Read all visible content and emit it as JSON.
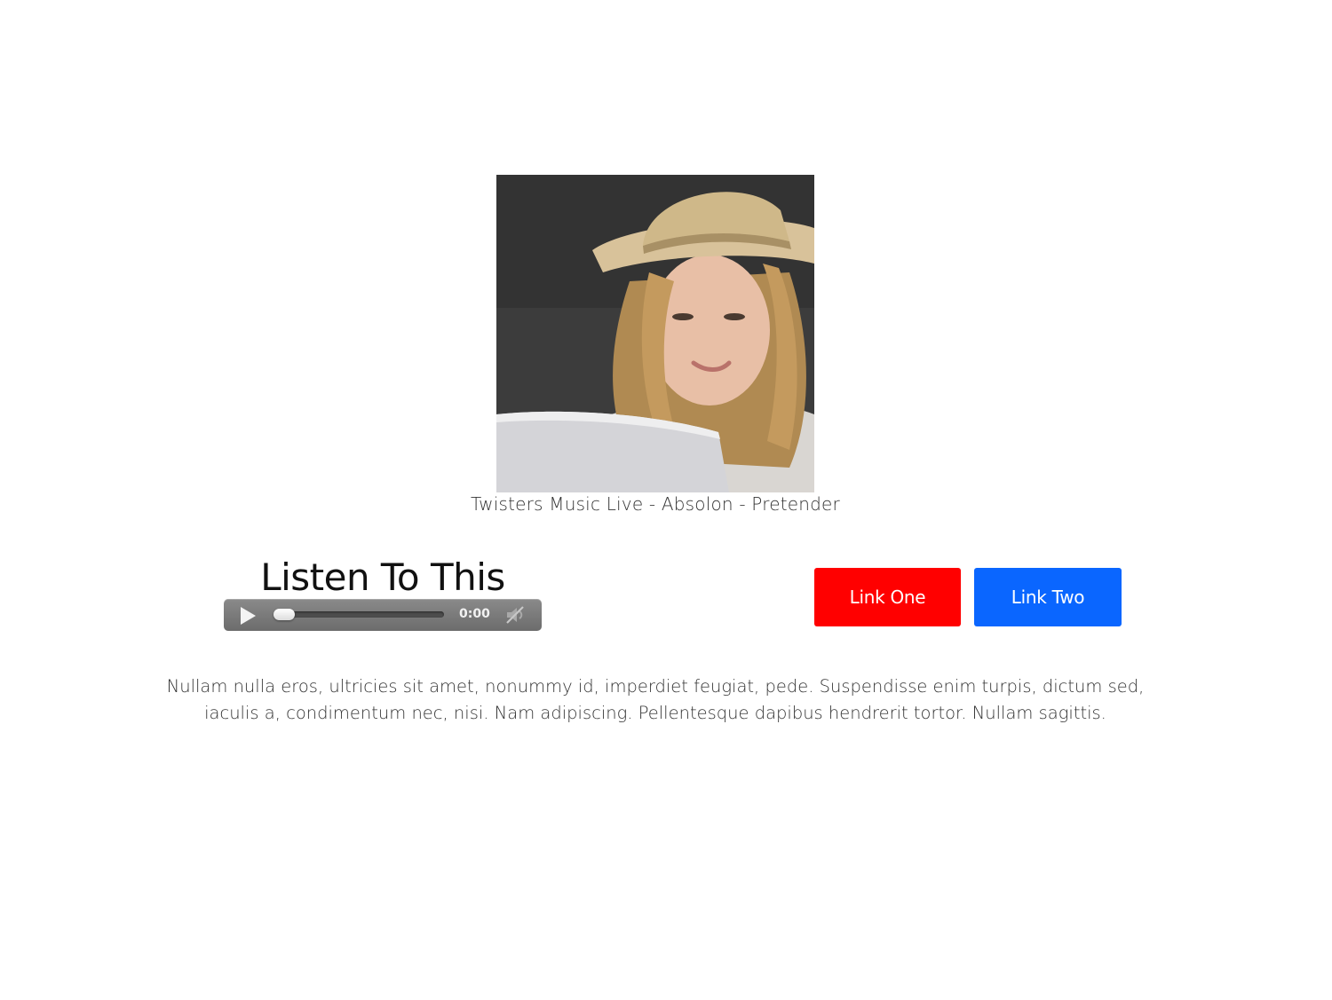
{
  "hero": {
    "caption": "Twisters Music Live - Absolon - Pretender"
  },
  "audio_section": {
    "title": "Listen To This",
    "player": {
      "time": "0:00",
      "progress": 0,
      "play_icon": "play-icon",
      "mute_icon": "muted-speaker-icon"
    }
  },
  "links": {
    "link_one": "Link One",
    "link_two": "Link Two"
  },
  "body": {
    "paragraph": "Nullam nulla eros, ultricies sit amet, nonummy id, imperdiet feugiat, pede. Suspendisse enim turpis, dictum sed, iaculis a, condimentum nec, nisi. Nam adipiscing. Pellentesque dapibus hendrerit tortor. Nullam sagittis."
  },
  "colors": {
    "link_one_bg": "#ff0000",
    "link_two_bg": "#0a66ff",
    "player_bg": "#7a7a7a"
  }
}
